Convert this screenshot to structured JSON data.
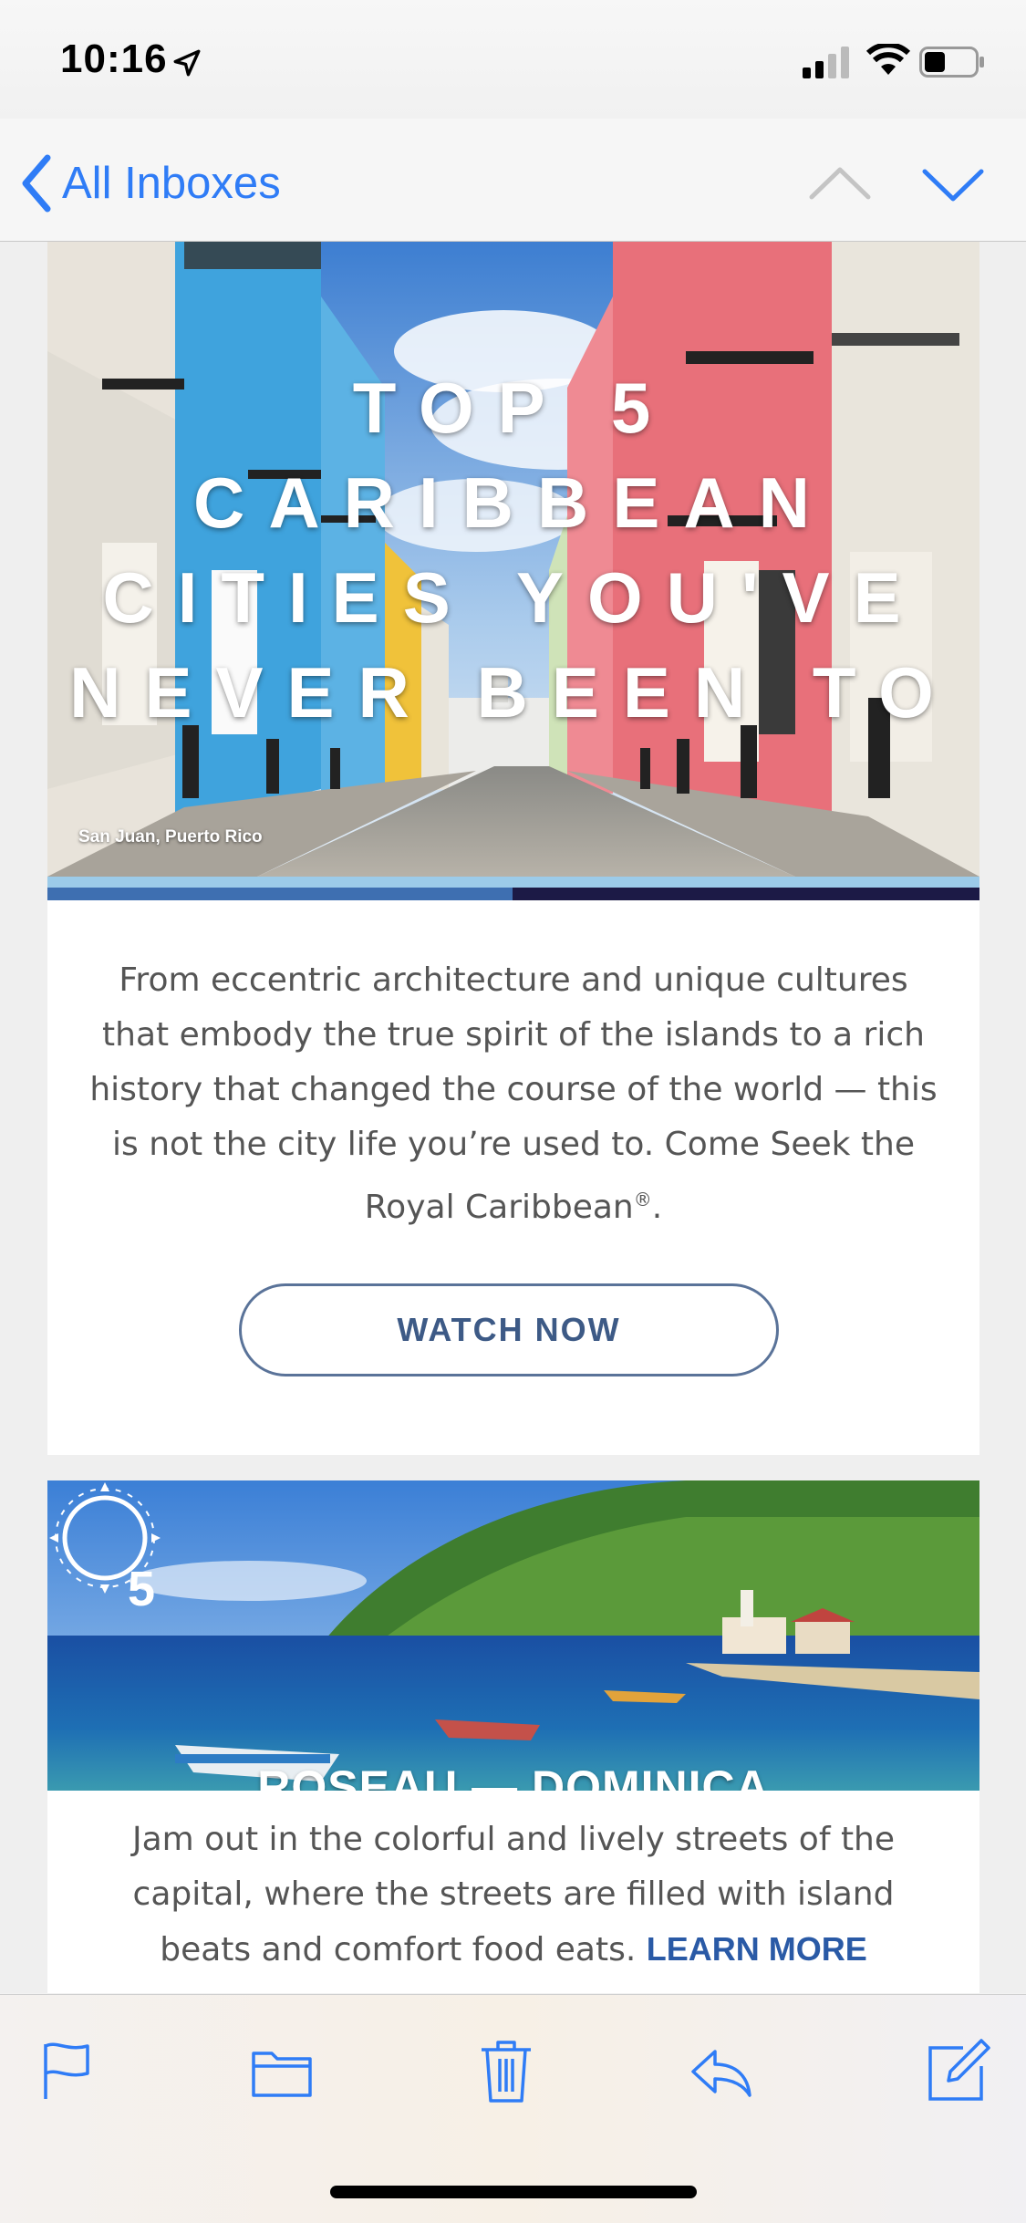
{
  "status_bar": {
    "time": "10:16"
  },
  "nav": {
    "back_label": "All Inboxes"
  },
  "email": {
    "hero": {
      "title_lines": [
        "TOP 5 CARIBBEAN",
        "CITIES YOU'VE",
        "NEVER BEEN TO"
      ],
      "caption": "San Juan, Puerto Rico"
    },
    "intro_text": "From eccentric architecture and unique cultures that embody the true spirit of the islands to a rich history that changed the course of the world — this is not the city life you’re used to. Come Seek the Royal Caribbean",
    "intro_reg": "®",
    "intro_end": ".",
    "watch_button": "WATCH NOW",
    "city_item": {
      "number": "5",
      "title": "ROSEAU — DOMINICA",
      "description": "Jam out in the colorful and lively streets of the capital, where the streets are filled with island beats and comfort food eats.",
      "learn_more": "LEARN MORE"
    }
  },
  "colors": {
    "ios_blue": "#2f7cf6",
    "button_border": "#5a7399",
    "learn_more": "#2a5aa6"
  },
  "toolbar": {
    "icons": [
      "flag-icon",
      "folder-icon",
      "trash-icon",
      "reply-icon",
      "compose-icon"
    ]
  }
}
